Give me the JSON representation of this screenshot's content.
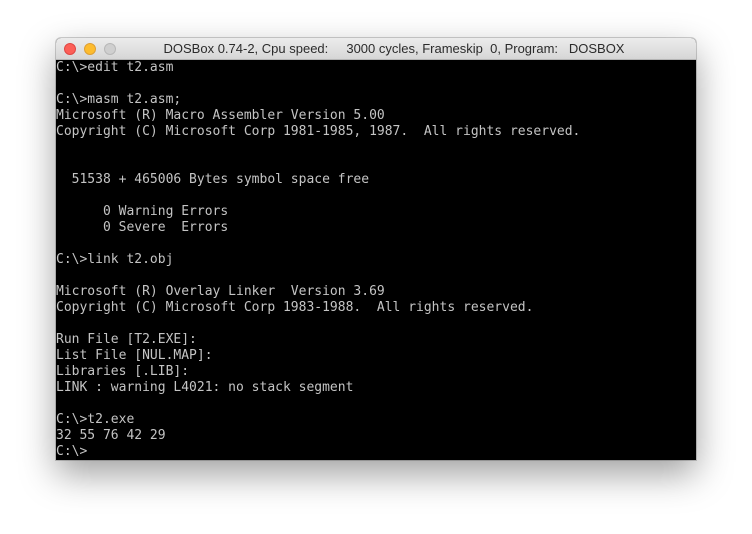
{
  "window": {
    "title": "DOSBox 0.74-2, Cpu speed:     3000 cycles, Frameskip  0, Program:   DOSBOX"
  },
  "terminal": {
    "lines": [
      "C:\\>edit t2.asm",
      "",
      "C:\\>masm t2.asm;",
      "Microsoft (R) Macro Assembler Version 5.00",
      "Copyright (C) Microsoft Corp 1981-1985, 1987.  All rights reserved.",
      "",
      "",
      "  51538 + 465006 Bytes symbol space free",
      "",
      "      0 Warning Errors",
      "      0 Severe  Errors",
      "",
      "C:\\>link t2.obj",
      "",
      "Microsoft (R) Overlay Linker  Version 3.69",
      "Copyright (C) Microsoft Corp 1983-1988.  All rights reserved.",
      "",
      "Run File [T2.EXE]:",
      "List File [NUL.MAP]:",
      "Libraries [.LIB]:",
      "LINK : warning L4021: no stack segment",
      "",
      "C:\\>t2.exe",
      "32 55 76 42 29",
      "C:\\>"
    ]
  }
}
